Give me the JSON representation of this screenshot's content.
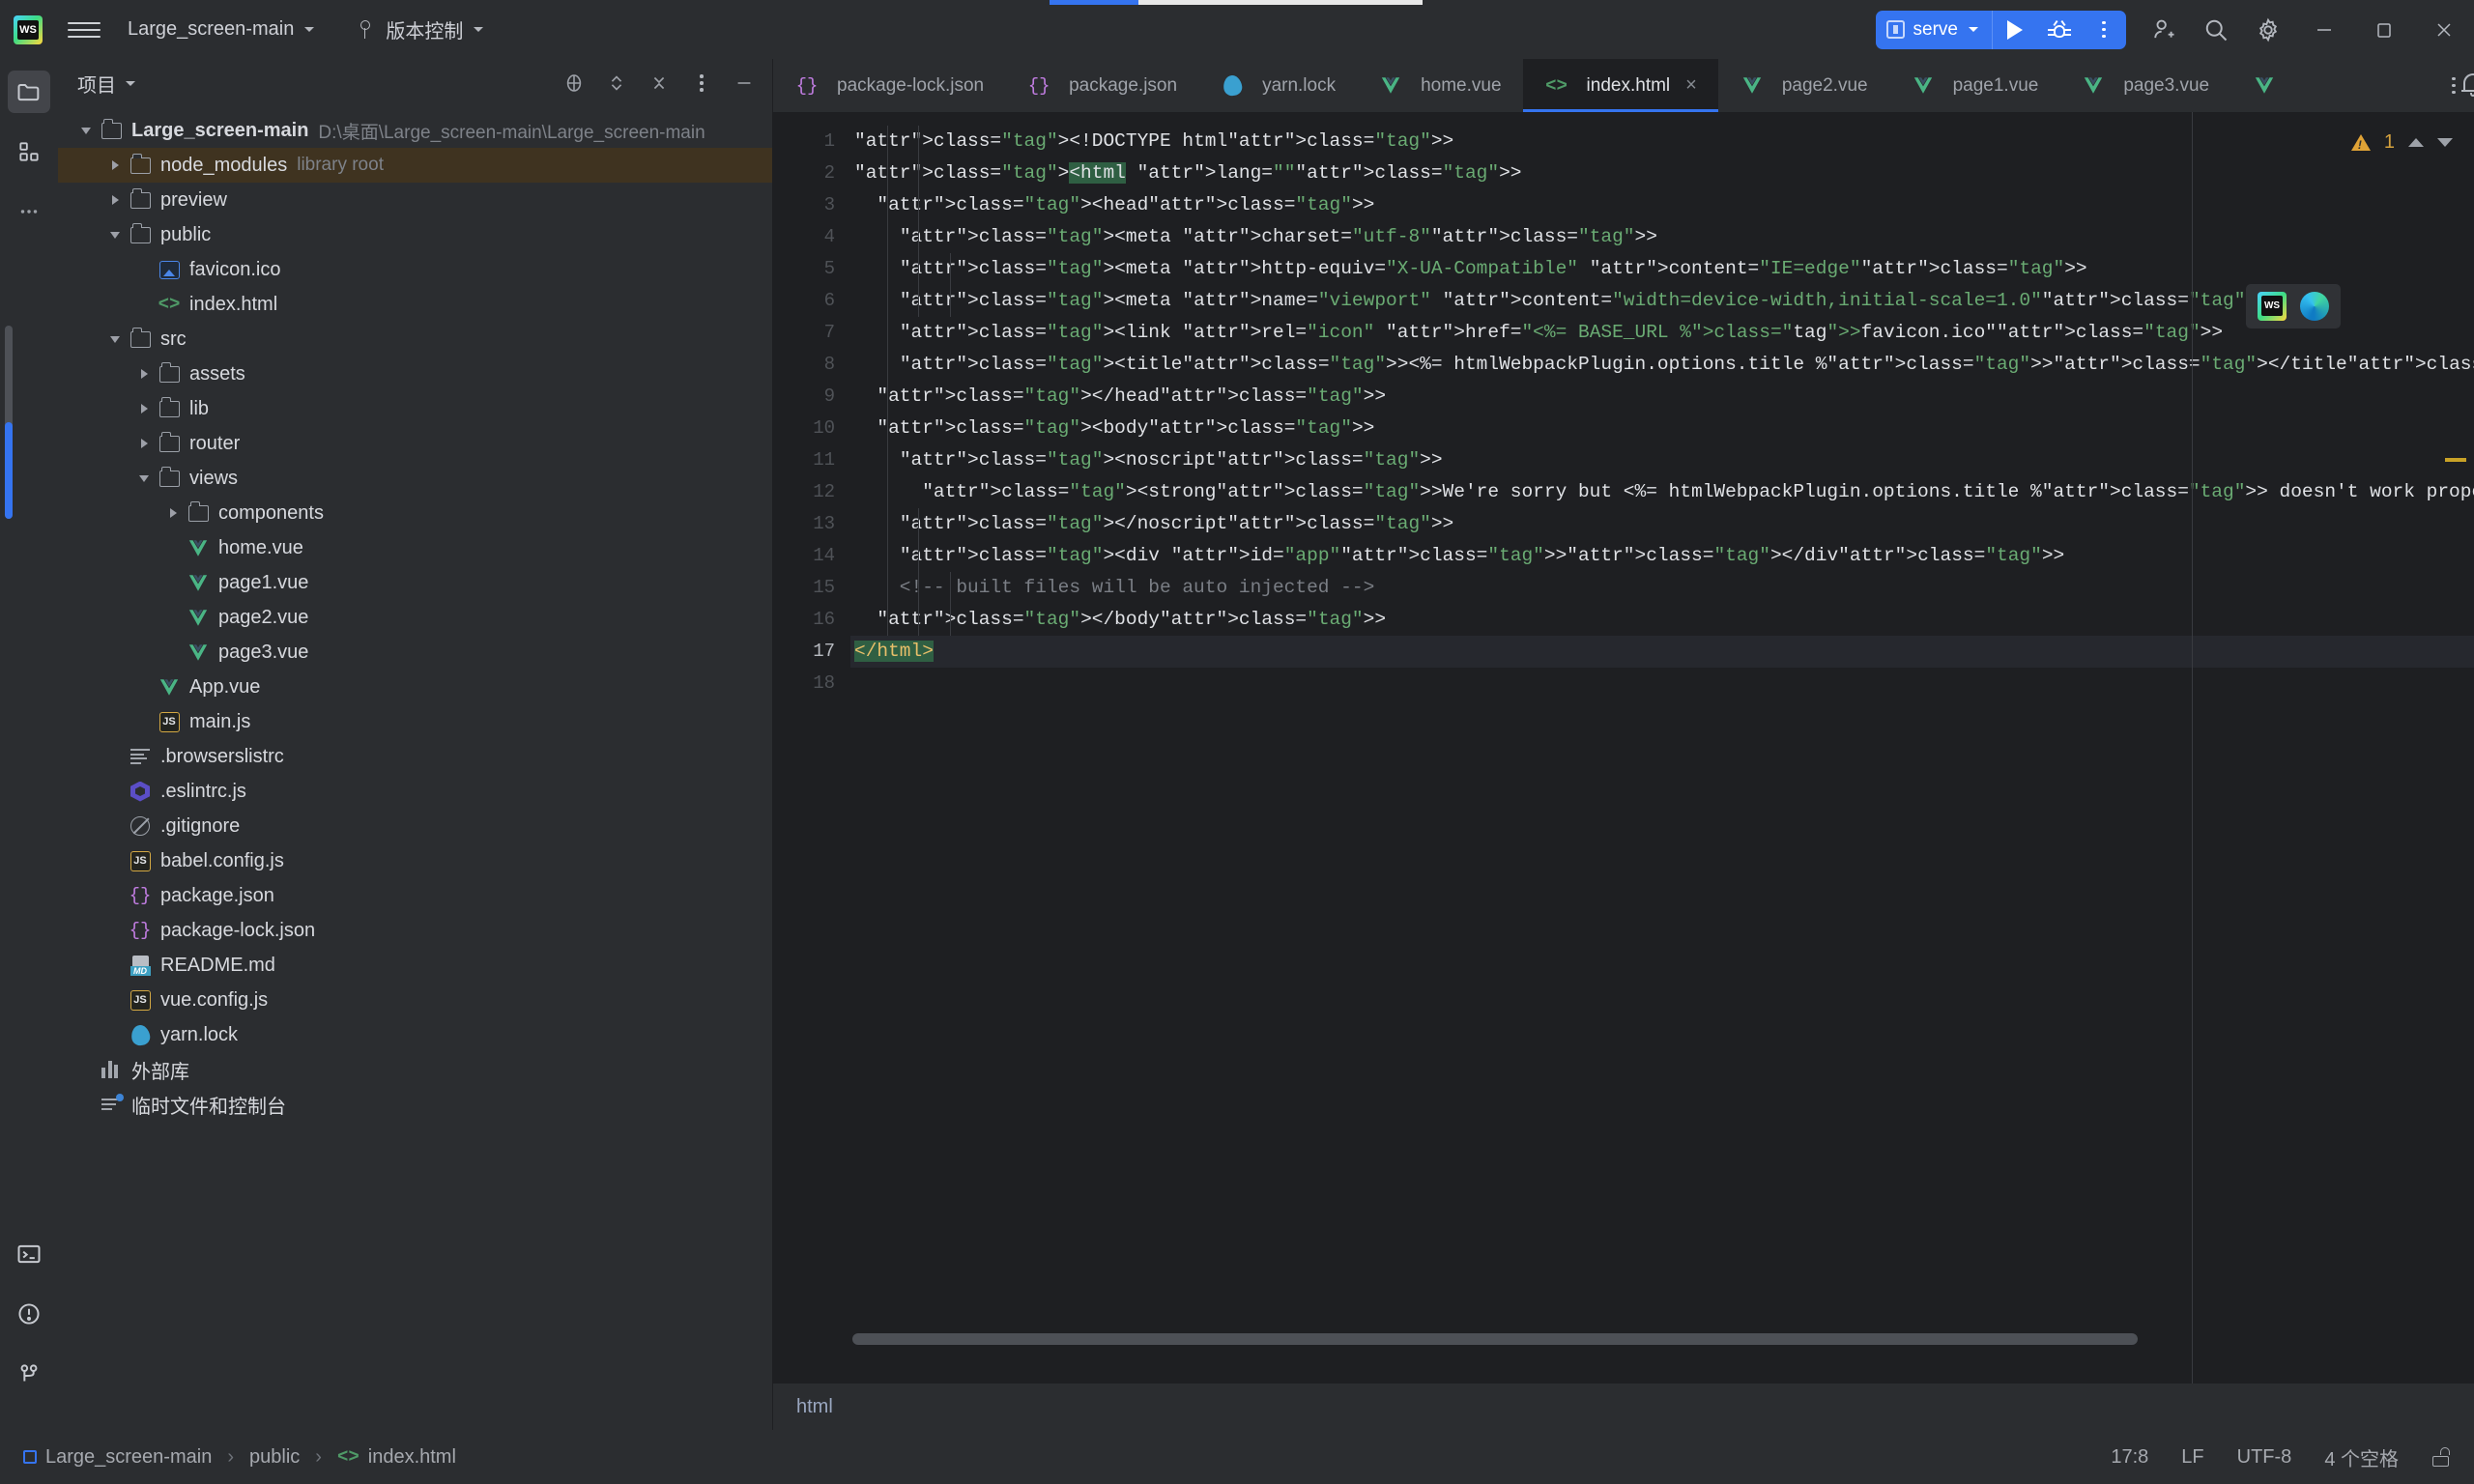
{
  "window": {
    "app_logo": "webstorm-logo-icon",
    "project_name": "Large_screen-main",
    "vcs_label": "版本控制",
    "minimize_label": "─",
    "maximize_label": "❐",
    "close_label": "✕",
    "progress_percent": 24
  },
  "run_widget": {
    "config_name": "serve",
    "run_tooltip": "Run",
    "debug_tooltip": "Debug",
    "more_tooltip": "More"
  },
  "toolbar_icons": [
    {
      "name": "add-user-icon"
    },
    {
      "name": "search-icon"
    },
    {
      "name": "gear-icon"
    }
  ],
  "rail": {
    "top_items": [
      {
        "name": "project-folder-icon",
        "active": true
      },
      {
        "name": "structure-squares-icon",
        "active": false
      },
      {
        "name": "more-dots-icon",
        "active": false
      }
    ],
    "bottom_items": [
      {
        "name": "terminal-icon"
      },
      {
        "name": "problems-icon"
      },
      {
        "name": "version-control-branch-icon"
      }
    ]
  },
  "project_panel": {
    "title": "项目",
    "actions": [
      {
        "name": "select-opened-file-icon"
      },
      {
        "name": "expand-collapse-icon"
      },
      {
        "name": "collapse-all-icon"
      },
      {
        "name": "options-kebab-icon"
      },
      {
        "name": "hide-panel-icon"
      }
    ],
    "tree": [
      {
        "depth": 0,
        "twisty": "open",
        "icon": "folder",
        "label": "Large_screen-main",
        "bold": true,
        "sub": "D:\\桌面\\Large_screen-main\\Large_screen-main"
      },
      {
        "depth": 1,
        "twisty": "closed",
        "icon": "folder",
        "label": "node_modules",
        "sub": "library root",
        "highlight": true
      },
      {
        "depth": 1,
        "twisty": "closed",
        "icon": "folder",
        "label": "preview"
      },
      {
        "depth": 1,
        "twisty": "open",
        "icon": "folder",
        "label": "public"
      },
      {
        "depth": 2,
        "twisty": "none",
        "icon": "image",
        "label": "favicon.ico"
      },
      {
        "depth": 2,
        "twisty": "none",
        "icon": "html",
        "label": "index.html"
      },
      {
        "depth": 1,
        "twisty": "open",
        "icon": "folder",
        "label": "src"
      },
      {
        "depth": 2,
        "twisty": "closed",
        "icon": "folder",
        "label": "assets"
      },
      {
        "depth": 2,
        "twisty": "closed",
        "icon": "folder",
        "label": "lib"
      },
      {
        "depth": 2,
        "twisty": "closed",
        "icon": "folder",
        "label": "router"
      },
      {
        "depth": 2,
        "twisty": "open",
        "icon": "folder",
        "label": "views"
      },
      {
        "depth": 3,
        "twisty": "closed",
        "icon": "folder",
        "label": "components"
      },
      {
        "depth": 3,
        "twisty": "none",
        "icon": "vue",
        "label": "home.vue"
      },
      {
        "depth": 3,
        "twisty": "none",
        "icon": "vue",
        "label": "page1.vue"
      },
      {
        "depth": 3,
        "twisty": "none",
        "icon": "vue",
        "label": "page2.vue"
      },
      {
        "depth": 3,
        "twisty": "none",
        "icon": "vue",
        "label": "page3.vue"
      },
      {
        "depth": 2,
        "twisty": "none",
        "icon": "vue",
        "label": "App.vue"
      },
      {
        "depth": 2,
        "twisty": "none",
        "icon": "js",
        "label": "main.js"
      },
      {
        "depth": 1,
        "twisty": "none",
        "icon": "lines",
        "label": ".browserslistrc"
      },
      {
        "depth": 1,
        "twisty": "none",
        "icon": "eslint",
        "label": ".eslintrc.js"
      },
      {
        "depth": 1,
        "twisty": "none",
        "icon": "gitignore",
        "label": ".gitignore"
      },
      {
        "depth": 1,
        "twisty": "none",
        "icon": "js",
        "label": "babel.config.js"
      },
      {
        "depth": 1,
        "twisty": "none",
        "icon": "json",
        "label": "package.json"
      },
      {
        "depth": 1,
        "twisty": "none",
        "icon": "json",
        "label": "package-lock.json"
      },
      {
        "depth": 1,
        "twisty": "none",
        "icon": "md",
        "label": "README.md"
      },
      {
        "depth": 1,
        "twisty": "none",
        "icon": "js",
        "label": "vue.config.js"
      },
      {
        "depth": 1,
        "twisty": "none",
        "icon": "yarn",
        "label": "yarn.lock"
      },
      {
        "depth": 0,
        "twisty": "none",
        "icon": "external",
        "label": "外部库"
      },
      {
        "depth": 0,
        "twisty": "none",
        "icon": "scratch",
        "label": "临时文件和控制台"
      }
    ]
  },
  "editor": {
    "tabs": [
      {
        "label": "package-lock.json",
        "icon": "json",
        "active": false
      },
      {
        "label": "package.json",
        "icon": "json",
        "active": false
      },
      {
        "label": "yarn.lock",
        "icon": "yarn",
        "active": false
      },
      {
        "label": "home.vue",
        "icon": "vue",
        "active": false
      },
      {
        "label": "index.html",
        "icon": "html",
        "active": true
      },
      {
        "label": "page2.vue",
        "icon": "vue",
        "active": false
      },
      {
        "label": "page1.vue",
        "icon": "vue",
        "active": false
      },
      {
        "label": "page3.vue",
        "icon": "vue",
        "active": false
      },
      {
        "label": "",
        "icon": "vue",
        "active": false
      }
    ],
    "tab_close_label": "×",
    "tab_overflow_label": "more-tabs-kebab-icon",
    "line_numbers": [
      "1",
      "2",
      "3",
      "4",
      "5",
      "6",
      "7",
      "8",
      "9",
      "10",
      "11",
      "12",
      "13",
      "14",
      "15",
      "16",
      "17",
      "18"
    ],
    "current_line": 17,
    "warning_count": "1",
    "browser_popup": [
      "webstorm-icon",
      "edge-browser-icon"
    ],
    "breadcrumb_tag": "html",
    "lines": [
      "<!DOCTYPE html>",
      "<html lang=\"\">",
      "  <head>",
      "    <meta charset=\"utf-8\">",
      "    <meta http-equiv=\"X-UA-Compatible\" content=\"IE=edge\">",
      "    <meta name=\"viewport\" content=\"width=device-width,initial-scale=1.0\">",
      "    <link rel=\"icon\" href=\"<%= BASE_URL %>favicon.ico\">",
      "    <title><%= htmlWebpackPlugin.options.title %></title>",
      "  </head>",
      "  <body>",
      "    <noscript>",
      "      <strong>We're sorry but <%= htmlWebpackPlugin.options.title %> doesn't work properly without JavaScript enabled. Please enable it",
      "    </noscript>",
      "    <div id=\"app\"></div>",
      "    <!-- built files will be auto injected -->",
      "  </body>",
      "</html>",
      ""
    ]
  },
  "statusbar": {
    "breadcrumb": [
      {
        "label": "Large_screen-main",
        "icon": "project-square-icon"
      },
      {
        "label": "public",
        "icon": ""
      },
      {
        "label": "index.html",
        "icon": "html"
      }
    ],
    "separator": "›",
    "caret_position": "17:8",
    "line_separator": "LF",
    "encoding": "UTF-8",
    "indent": "4 个空格",
    "lock_icon": "unlocked-icon",
    "notifications_icon": "bell-icon"
  }
}
